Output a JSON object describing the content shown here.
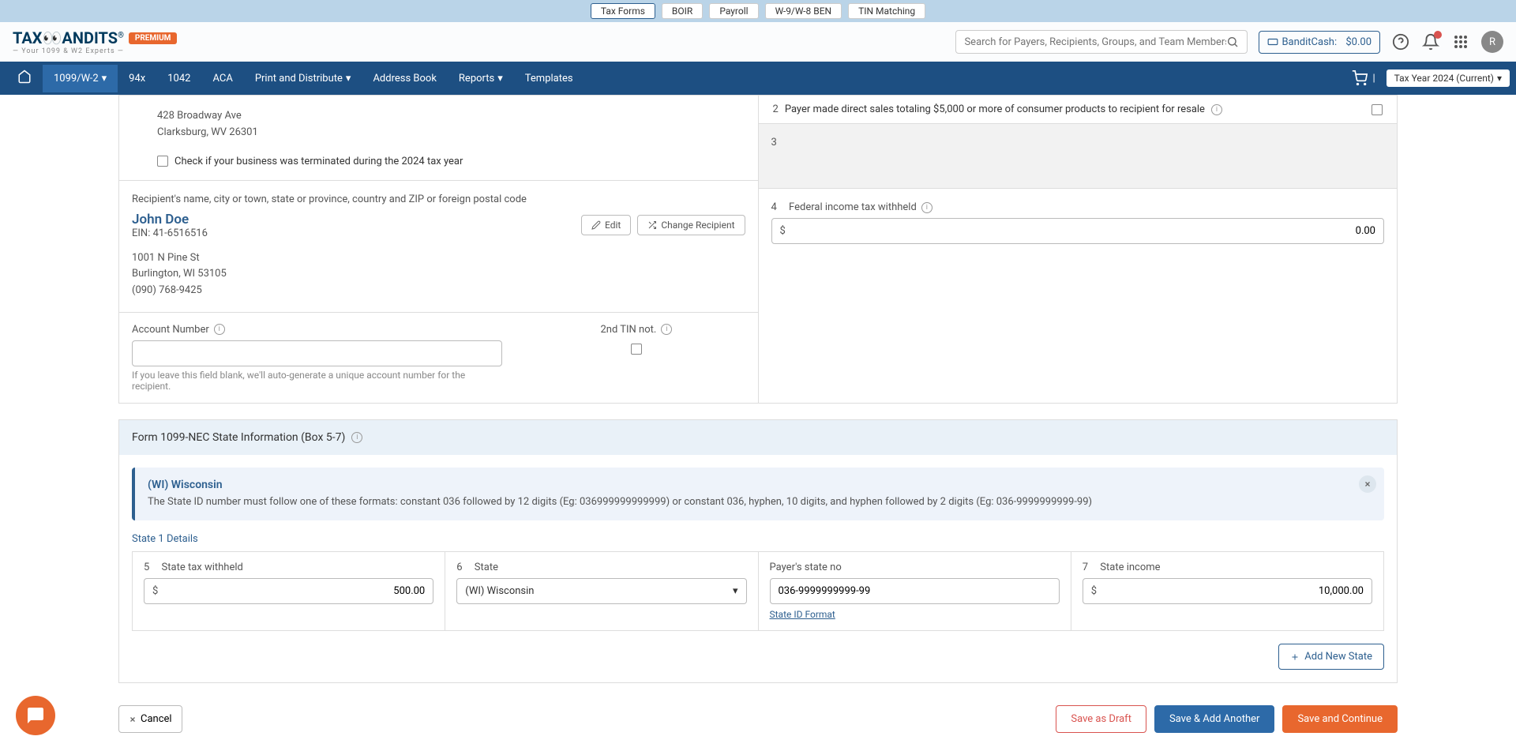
{
  "topTabs": [
    "Tax Forms",
    "BOIR",
    "Payroll",
    "W-9/W-8 BEN",
    "TIN Matching"
  ],
  "logo": {
    "pre": "TAX",
    "post": "ANDITS",
    "premium": "PREMIUM",
    "tagline": "— Your 1099 & W2 Experts —",
    "reg": "®"
  },
  "search": {
    "placeholder": "Search for Payers, Recipients, Groups, and Team Members"
  },
  "banditCash": {
    "label": "BanditCash:",
    "value": "$0.00"
  },
  "avatar": "R",
  "nav": {
    "items": [
      "1099/W-2",
      "94x",
      "1042",
      "ACA",
      "Print and Distribute",
      "Address Book",
      "Reports",
      "Templates"
    ],
    "taxYear": "Tax Year 2024 (Current)"
  },
  "payer": {
    "street": "428 Broadway Ave",
    "cityline": "Clarksburg, WV 26301",
    "termCheck": "Check if your business was terminated during the 2024 tax year"
  },
  "recipient": {
    "sectionLabel": "Recipient's name, city or town, state or province, country and ZIP or foreign postal code",
    "name": "John Doe",
    "ein": "EIN: 41-6516516",
    "street": "1001 N Pine St",
    "cityline": "Burlington, WI 53105",
    "phone": "(090) 768-9425",
    "edit": "Edit",
    "change": "Change Recipient"
  },
  "account": {
    "label": "Account Number",
    "hint": "If you leave this field blank, we'll auto-generate a unique account number for the recipient.",
    "tin2": "2nd TIN not."
  },
  "box2": {
    "num": "2",
    "label": "Payer made direct sales totaling $5,000 or more of consumer products to recipient for resale"
  },
  "box3": {
    "num": "3"
  },
  "box4": {
    "num": "4",
    "label": "Federal income tax withheld",
    "value": "0.00"
  },
  "stateSection": {
    "title": "Form 1099-NEC   State Information   (Box 5-7)",
    "alertTitle": "(WI) Wisconsin",
    "alertText": "The State ID number must follow one of these formats: constant 036 followed by 12 digits (Eg: 036999999999999) or constant 036, hyphen, 10 digits, and hyphen followed by 2 digits (Eg: 036-9999999999-99)",
    "subtitle": "State 1 Details"
  },
  "box5": {
    "num": "5",
    "label": "State tax withheld",
    "value": "500.00"
  },
  "box6": {
    "num": "6",
    "label": "State",
    "value": "(WI) Wisconsin",
    "payerStateLabel": "Payer's state no",
    "payerStateValue": "036-9999999999-99",
    "link": "State ID Format"
  },
  "box7": {
    "num": "7",
    "label": "State income",
    "value": "10,000.00"
  },
  "addState": "Add New State",
  "footer": {
    "cancel": "Cancel",
    "draft": "Save as Draft",
    "another": "Save & Add Another",
    "continue": "Save and Continue"
  }
}
